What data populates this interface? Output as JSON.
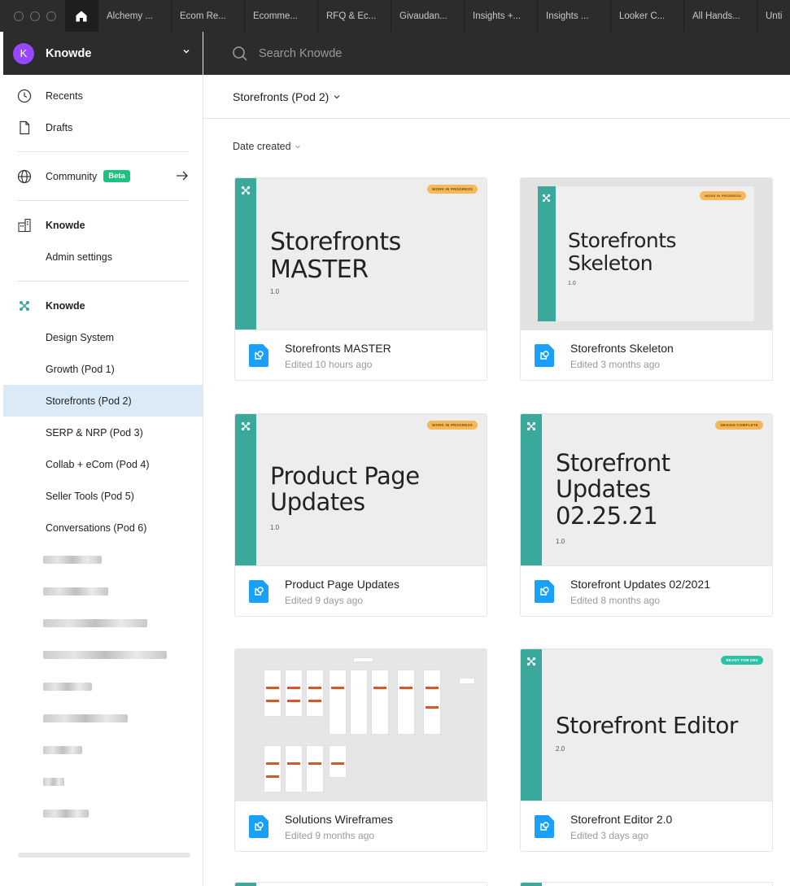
{
  "tabs": {
    "items": [
      "Alchemy ...",
      "Ecom Re...",
      "Ecomme...",
      "RFQ & Ec...",
      "Givaudan...",
      "Insights +...",
      "Insights ...",
      "Looker C...",
      "All Hands...",
      "Untit"
    ]
  },
  "org": {
    "initial": "K",
    "name": "Knowde"
  },
  "search": {
    "placeholder": "Search Knowde"
  },
  "sidebar": {
    "recents": "Recents",
    "drafts": "Drafts",
    "community": "Community",
    "beta": "Beta",
    "team_section": "Knowde",
    "admin_settings": "Admin settings",
    "project_section": "Knowde",
    "projects": [
      "Design System",
      "Growth (Pod 1)",
      "Storefronts (Pod 2)",
      "SERP & NRP (Pod 3)",
      "Collab + eCom (Pod 4)",
      "Seller Tools (Pod 5)",
      "Conversations (Pod 6)"
    ],
    "selected_project": "Storefronts (Pod 2)",
    "blurred_items_count": 9
  },
  "main": {
    "breadcrumb": "Storefronts (Pod 2)",
    "sort_label": "Date created"
  },
  "files": [
    {
      "name": "Storefronts MASTER",
      "edited": "Edited 10 hours ago",
      "thumb_title": "Storefronts MASTER",
      "thumb_version": "1.0",
      "badge": "WORK IN PROGRESS",
      "badge_color": "#f7b85c"
    },
    {
      "name": "Storefronts Skeleton",
      "edited": "Edited 3 months ago",
      "thumb_title": "Storefronts Skeleton",
      "thumb_version": "1.0",
      "badge": "WORK IN PROGRESS",
      "badge_color": "#f7b85c"
    },
    {
      "name": "Product Page Updates",
      "edited": "Edited 9 days ago",
      "thumb_title": "Product Page Updates",
      "thumb_version": "1.0",
      "badge": "WORK IN PROGRESS",
      "badge_color": "#f7b85c"
    },
    {
      "name": "Storefront Updates 02/2021",
      "edited": "Edited 8 months ago",
      "thumb_title": "Storefront Updates 02.25.21",
      "thumb_version": "1.0",
      "badge": "DESIGN COMPLETE",
      "badge_color": "#f4b65b"
    },
    {
      "name": "Solutions Wireframes",
      "edited": "Edited 9 months ago"
    },
    {
      "name": "Storefront Editor 2.0",
      "edited": "Edited 3 days ago",
      "thumb_title": "Storefront Editor",
      "thumb_version": "2.0",
      "badge": "READY FOR DEV",
      "badge_color": "#2fc1a8"
    }
  ],
  "colors": {
    "chrome_dark": "#2c2c2c",
    "accent_teal": "#3aa99b",
    "selected_bg": "#daebf7",
    "beta_green": "#1bc47d",
    "file_icon_blue": "#18a0fb",
    "avatar_purple": "#9747ff"
  }
}
